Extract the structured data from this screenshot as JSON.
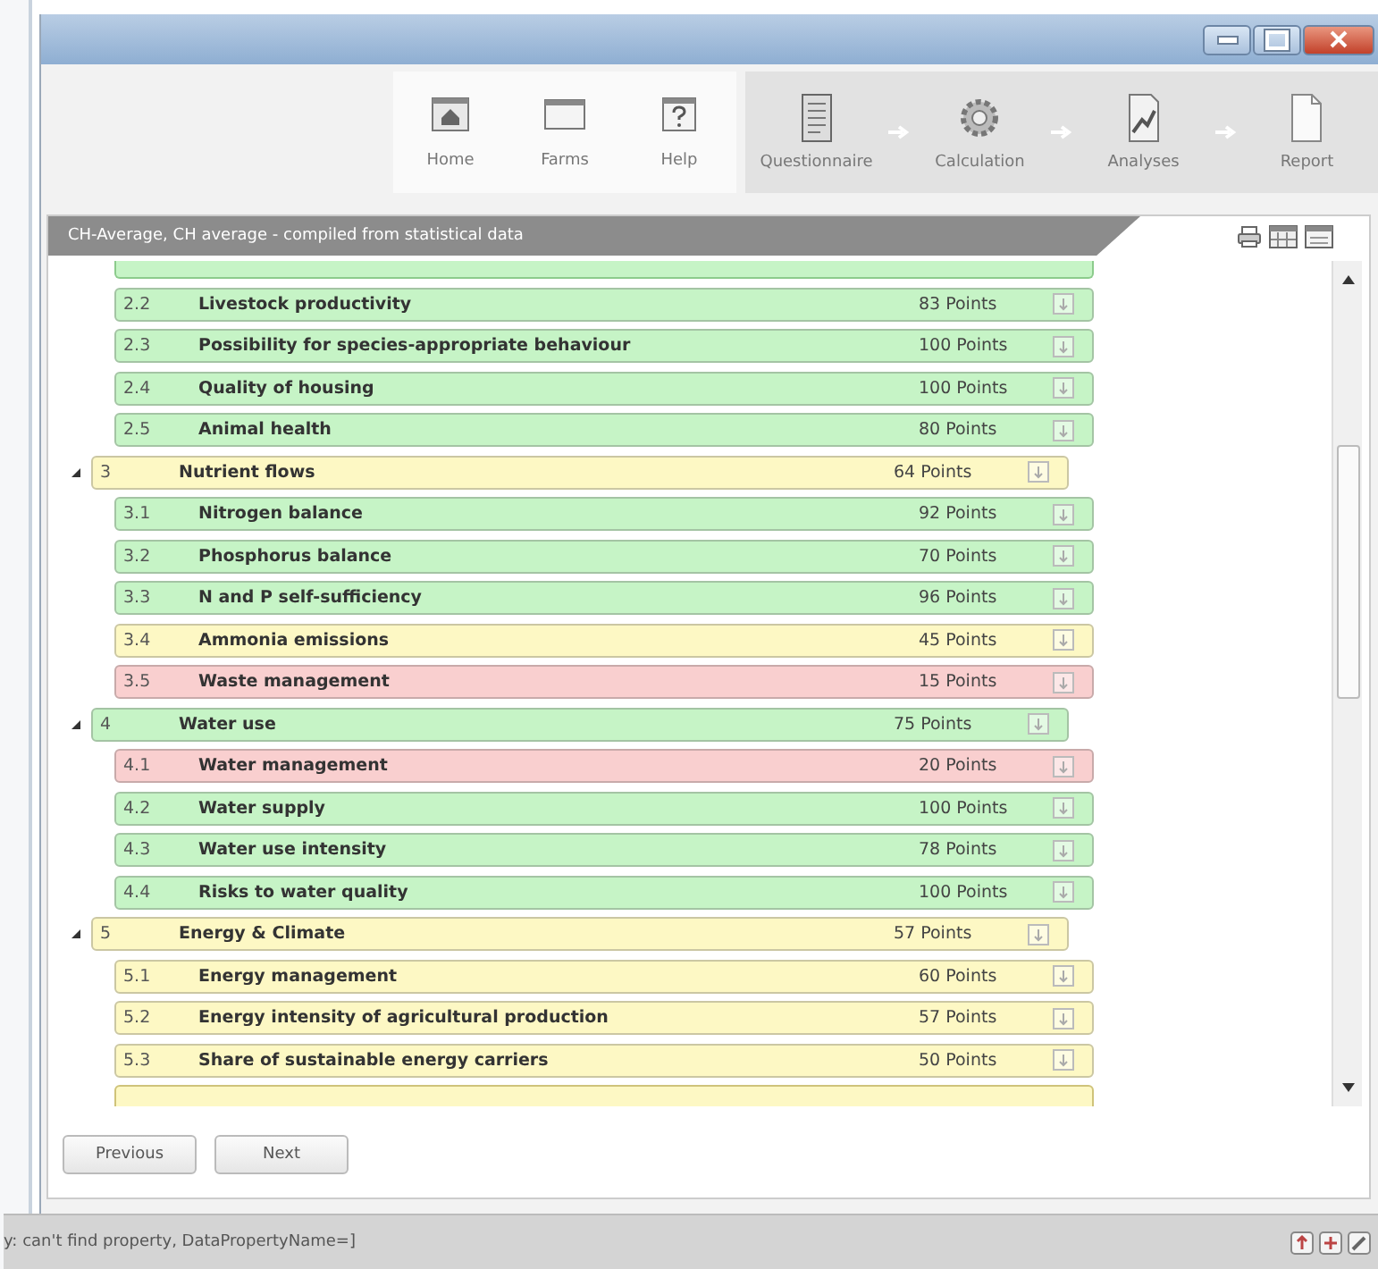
{
  "toolbar": {
    "navigation": [
      {
        "label": "Home"
      },
      {
        "label": "Farms"
      },
      {
        "label": "Help"
      }
    ],
    "workflow": [
      {
        "label": "Questionnaire"
      },
      {
        "label": "Calculation"
      },
      {
        "label": "Analyses"
      },
      {
        "label": "Report"
      }
    ]
  },
  "panel": {
    "title": "CH-Average, CH average - compiled from statistical data"
  },
  "tree": [
    {
      "kind": "item",
      "number": "2.2",
      "title": "Livestock productivity",
      "points": "83 Points",
      "color": "#c6f4c6"
    },
    {
      "kind": "item",
      "number": "2.3",
      "title": "Possibility for species-appropriate behaviour",
      "points": "100 Points",
      "color": "#c6f4c6"
    },
    {
      "kind": "item",
      "number": "2.4",
      "title": "Quality of housing",
      "points": "100 Points",
      "color": "#c6f4c6"
    },
    {
      "kind": "item",
      "number": "2.5",
      "title": "Animal health",
      "points": "80 Points",
      "color": "#c6f4c6"
    },
    {
      "kind": "group",
      "number": "3",
      "title": "Nutrient flows",
      "points": "64 Points",
      "color": "#fdf8c4",
      "expanded": true,
      "children": [
        {
          "kind": "item",
          "number": "3.1",
          "title": "Nitrogen balance",
          "points": "92 Points",
          "color": "#c6f4c6"
        },
        {
          "kind": "item",
          "number": "3.2",
          "title": "Phosphorus balance",
          "points": "70 Points",
          "color": "#c6f4c6"
        },
        {
          "kind": "item",
          "number": "3.3",
          "title": "N and P self-sufficiency",
          "points": "96 Points",
          "color": "#c6f4c6"
        },
        {
          "kind": "item",
          "number": "3.4",
          "title": "Ammonia emissions",
          "points": "45 Points",
          "color": "#fdf8c4"
        },
        {
          "kind": "item",
          "number": "3.5",
          "title": "Waste management",
          "points": "15 Points",
          "color": "#f9cfcf"
        }
      ]
    },
    {
      "kind": "group",
      "number": "4",
      "title": "Water use",
      "points": "75 Points",
      "color": "#c6f4c6",
      "expanded": true,
      "children": [
        {
          "kind": "item",
          "number": "4.1",
          "title": "Water management",
          "points": "20 Points",
          "color": "#f9cfcf"
        },
        {
          "kind": "item",
          "number": "4.2",
          "title": "Water supply",
          "points": "100 Points",
          "color": "#c6f4c6"
        },
        {
          "kind": "item",
          "number": "4.3",
          "title": "Water use intensity",
          "points": "78 Points",
          "color": "#c6f4c6"
        },
        {
          "kind": "item",
          "number": "4.4",
          "title": "Risks to water quality",
          "points": "100 Points",
          "color": "#c6f4c6"
        }
      ]
    },
    {
      "kind": "group",
      "number": "5",
      "title": "Energy & Climate",
      "points": "57 Points",
      "color": "#fdf8c4",
      "expanded": true,
      "children": [
        {
          "kind": "item",
          "number": "5.1",
          "title": "Energy management",
          "points": "60 Points",
          "color": "#fdf8c4"
        },
        {
          "kind": "item",
          "number": "5.2",
          "title": "Energy intensity of agricultural production",
          "points": "57 Points",
          "color": "#fdf8c4"
        },
        {
          "kind": "item",
          "number": "5.3",
          "title": "Share of sustainable energy carriers",
          "points": "50 Points",
          "color": "#fdf8c4"
        }
      ]
    }
  ],
  "buttons": [
    "Previous",
    "Next"
  ],
  "status_bar": {
    "message": "y: can't find property, DataPropertyName=]"
  }
}
